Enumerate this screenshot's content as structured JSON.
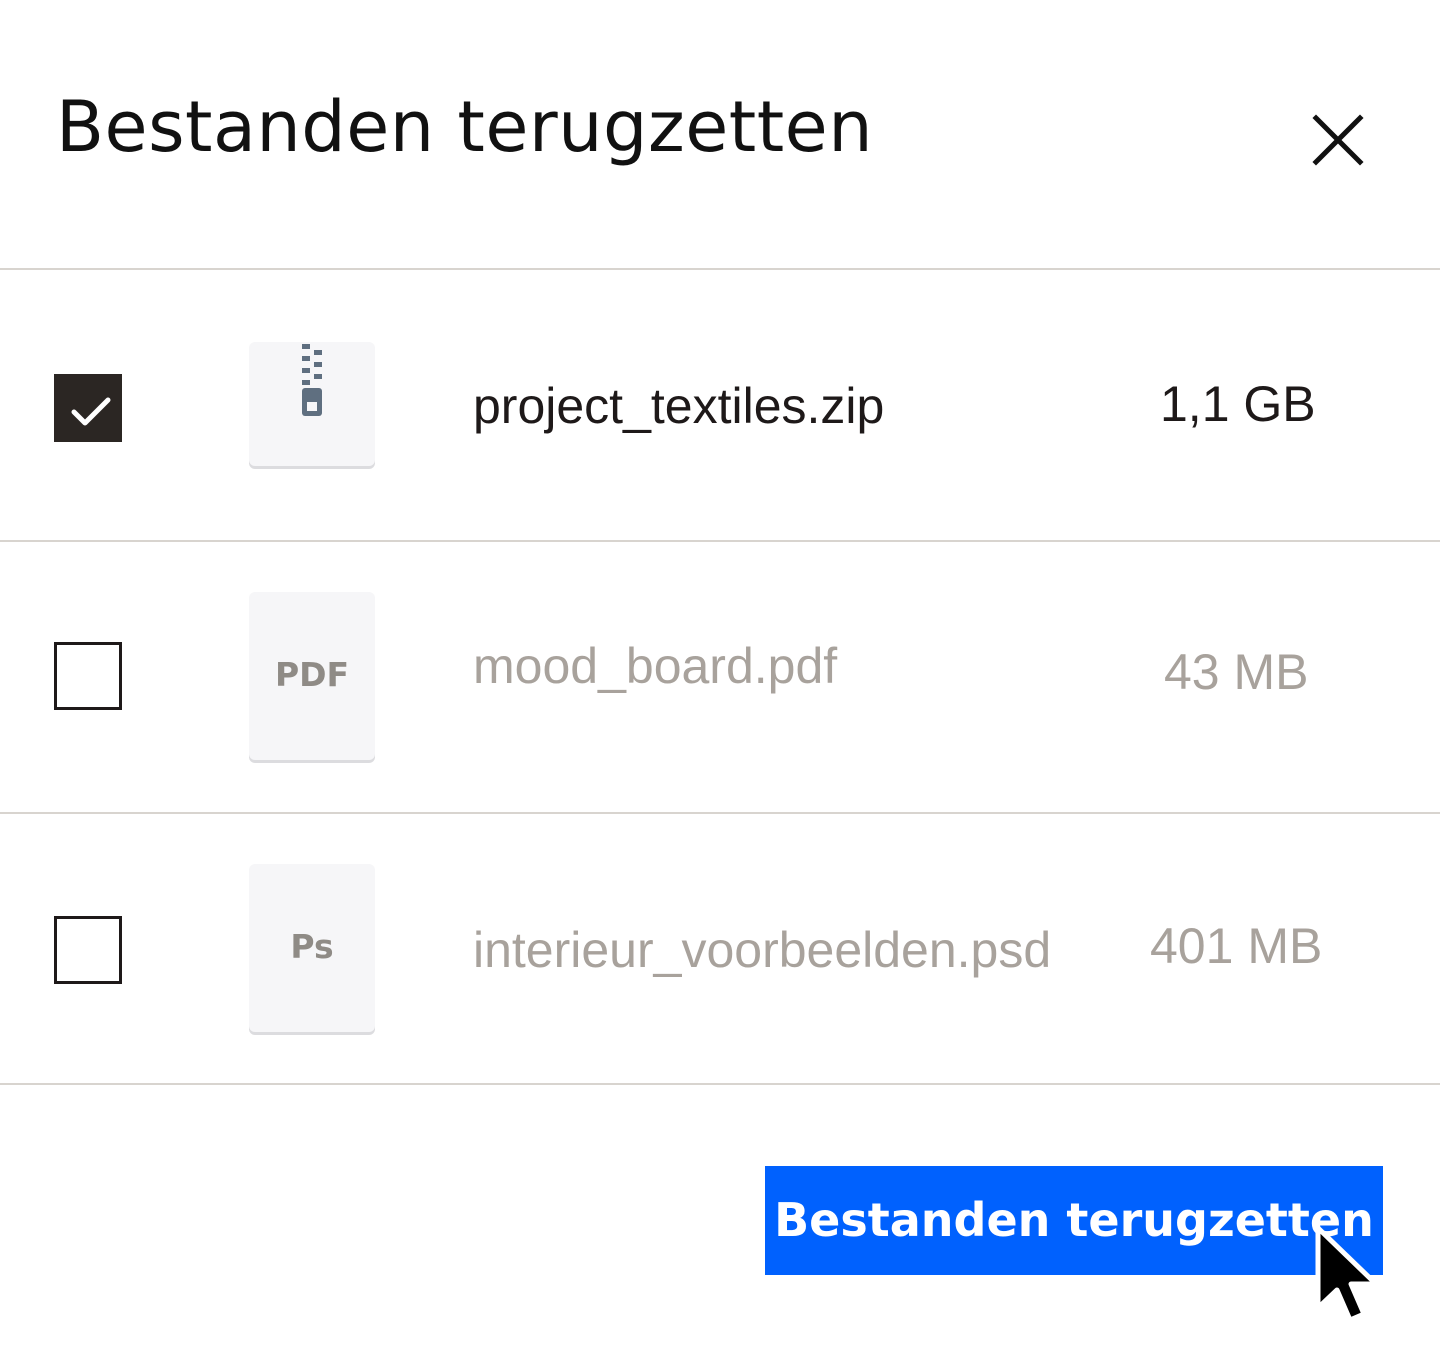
{
  "dialog": {
    "title": "Bestanden terugzetten",
    "close_icon": "close-icon"
  },
  "files": [
    {
      "name": "project_textiles.zip",
      "size": "1,1 GB",
      "checked": true,
      "icon": "zip-file-icon",
      "thumb_label": ""
    },
    {
      "name": "mood_board.pdf",
      "size": "43 MB",
      "checked": false,
      "icon": "pdf-file-icon",
      "thumb_label": "PDF"
    },
    {
      "name": "interieur_voorbeelden.psd",
      "size": "401 MB",
      "checked": false,
      "icon": "psd-file-icon",
      "thumb_label": "Ps"
    }
  ],
  "footer": {
    "restore_button_label": "Bestanden terugzetten"
  },
  "colors": {
    "accent": "#0061fe",
    "checkbox_checked": "#2b2623",
    "text_active": "#1e1919",
    "text_muted": "#a8a29c",
    "divider": "#d8d4cf"
  },
  "pointer_icon": "mouse-pointer-icon"
}
